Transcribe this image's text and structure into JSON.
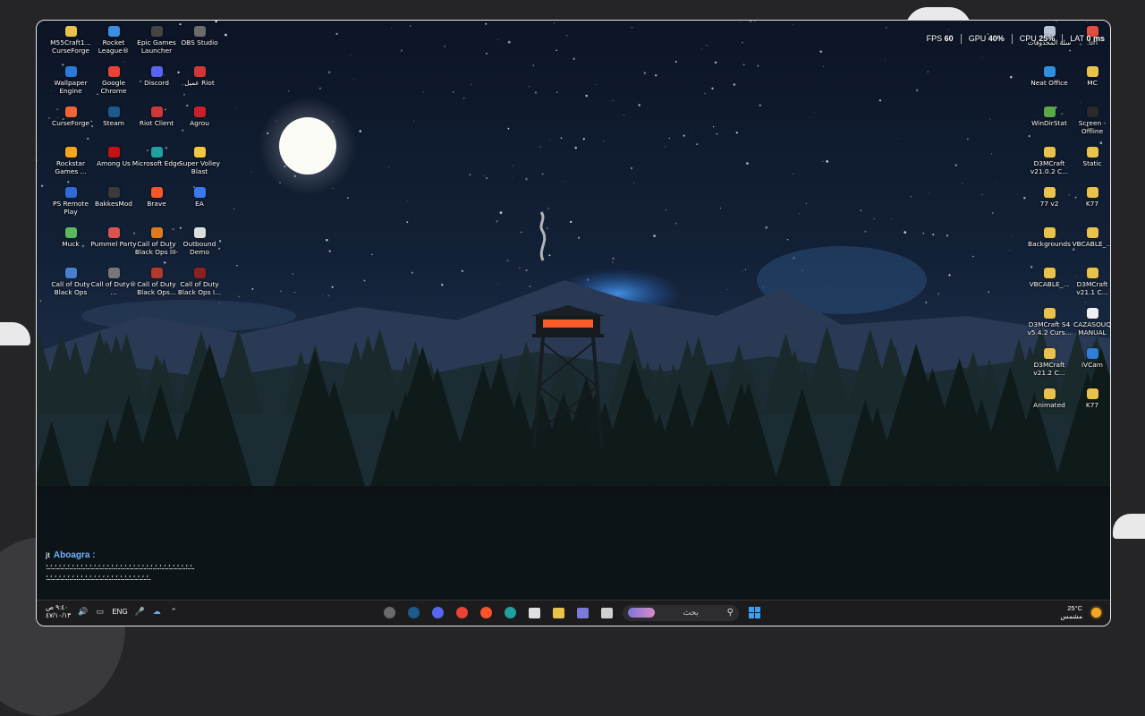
{
  "desktop": {
    "left_icons": [
      {
        "label": "M55Craft1... CurseForge",
        "color": "#e7c14b"
      },
      {
        "label": "Rocket League®",
        "color": "#3c8fe0"
      },
      {
        "label": "Epic Games Launcher",
        "color": "#444444"
      },
      {
        "label": "OBS Studio",
        "color": "#6b6b6b"
      },
      {
        "label": "Wallpaper Engine",
        "color": "#2a7bd8"
      },
      {
        "label": "Google Chrome",
        "color": "#e84335"
      },
      {
        "label": "Discord",
        "color": "#5865f2"
      },
      {
        "label": "عميل Riot",
        "color": "#d13639"
      },
      {
        "label": "CurseForge",
        "color": "#f16436"
      },
      {
        "label": "Steam",
        "color": "#1d5a8c"
      },
      {
        "label": "Riot Client",
        "color": "#d13639"
      },
      {
        "label": "Agrou",
        "color": "#c8202a"
      },
      {
        "label": "Rockstar Games ...",
        "color": "#f3a61b"
      },
      {
        "label": "Among Us",
        "color": "#c51111"
      },
      {
        "label": "Microsoft Edge",
        "color": "#1fa1a0"
      },
      {
        "label": "Super Volley Blast",
        "color": "#f2c740"
      },
      {
        "label": "PS Remote Play",
        "color": "#2e6bd6"
      },
      {
        "label": "BakkesMod",
        "color": "#3a3a3a"
      },
      {
        "label": "Brave",
        "color": "#fb542b"
      },
      {
        "label": "EA",
        "color": "#3a78f2"
      },
      {
        "label": "Muck",
        "color": "#5cb85c"
      },
      {
        "label": "Pummel Party",
        "color": "#d9534f"
      },
      {
        "label": "Call of Duty Black Ops III-",
        "color": "#e07a1f"
      },
      {
        "label": "Outbound Demo",
        "color": "#dddddd"
      },
      {
        "label": "Call of Duty Black Ops",
        "color": "#4a7fd0"
      },
      {
        "label": "Call of Duty® ...",
        "color": "#777777"
      },
      {
        "label": "Call of Duty Black Ops...",
        "color": "#b33a2a"
      },
      {
        "label": "Call of Duty Black Ops I...",
        "color": "#8a2020"
      }
    ],
    "right_icons": [
      {
        "label": "سلة المحذوفات",
        "color": "#b8c4d6"
      },
      {
        "label": ".url",
        "color": "#e74c3c"
      },
      {
        "label": "Neat Office",
        "color": "#2f8ee0"
      },
      {
        "label": "MC",
        "color": "#e8c24a"
      },
      {
        "label": "WinDirStat",
        "color": "#5aa84a"
      },
      {
        "label": "Screen - Offline",
        "color": "#2a2a2a"
      },
      {
        "label": "D3MCraft v21.0.2 C...",
        "color": "#e8c24a"
      },
      {
        "label": "Static",
        "color": "#e8c24a"
      },
      {
        "label": "77 v2",
        "color": "#e8c24a"
      },
      {
        "label": "K77",
        "color": "#e8c24a"
      },
      {
        "label": "Backgrounds",
        "color": "#e8c24a"
      },
      {
        "label": "VBCABLE_...",
        "color": "#e8c24a"
      },
      {
        "label": "VBCABLE_...",
        "color": "#e8c24a"
      },
      {
        "label": "D3MCraft v21.1 C...",
        "color": "#e8c24a"
      },
      {
        "label": "D3MCraft S4 v5.4.2 Curs...",
        "color": "#e8c24a"
      },
      {
        "label": "CAZASOUQ MANUAL",
        "color": "#f0f0f0"
      },
      {
        "label": "D3MCraft v21.2 C...",
        "color": "#e8c24a"
      },
      {
        "label": "iVCam",
        "color": "#2f7fd8"
      },
      {
        "label": "Animated",
        "color": "#e8c24a"
      },
      {
        "label": "K77",
        "color": "#e8c24a"
      }
    ]
  },
  "perf": {
    "fps_label": "FPS",
    "fps_value": "60",
    "gpu_label": "GPU",
    "gpu_value": "40%",
    "cpu_label": "CPU",
    "cpu_value": "25%",
    "lat_label": "LAT",
    "lat_value": "0 ms"
  },
  "chat": {
    "channel_icon": "jt",
    "username": "Aboagra",
    "colon": ":",
    "line1": "ـ؛ـ؛ـ؛ـ؛ـ؛ـ؛ـ؛ـ؛ـ؛ـ؛ـ؛ـ؛ـ؛ـ؛ـ؛ـ؛ـ؛ـ؛ـ؛ـ؛ـ؛ـ؛ـ؛ـ؛ـ؛ـ؛ـ؛ـ؛ـ؛ـ؛ـ؛ـ؛ـ؛ـ؛",
    "line2": "ـ؛ـ؛ـ؛ـ؛ـ؛ـ؛ـ؛ـ؛ـ؛ـ؛ـ؛ـ؛ـ؛ـ؛ـ؛ـ؛ـ؛ـ؛ـ؛ـ؛ـ؛ـ؛ـ؛ـ؛"
  },
  "taskbar": {
    "time": "٩:٤٠ ص",
    "date": "٤٧/١٠/١٣",
    "language": "ENG",
    "search_placeholder": "بحث",
    "weather_temp": "25°C",
    "weather_desc": "مشمس",
    "apps": [
      {
        "name": "clock-app",
        "color": "#6a6a6a"
      },
      {
        "name": "steam",
        "color": "#1d5a8c"
      },
      {
        "name": "discord",
        "color": "#5865f2"
      },
      {
        "name": "chrome",
        "color": "#e84335"
      },
      {
        "name": "brave",
        "color": "#fb542b"
      },
      {
        "name": "edge",
        "color": "#1fa1a0"
      },
      {
        "name": "store",
        "color": "#e0e0e0"
      },
      {
        "name": "file-explorer",
        "color": "#e8c24a"
      },
      {
        "name": "copilot",
        "color": "#7a7ad8"
      },
      {
        "name": "window-app",
        "color": "#d0d0d0"
      }
    ]
  }
}
